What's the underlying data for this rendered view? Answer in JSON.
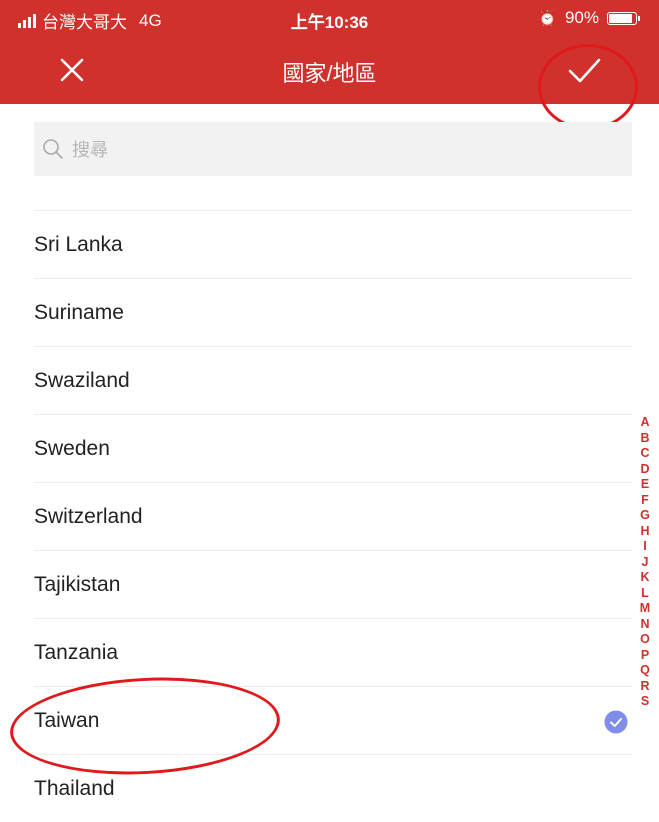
{
  "status_bar": {
    "carrier": "台灣大哥大",
    "network": "4G",
    "time": "上午10:36",
    "battery": "90%",
    "battery_level": 0.9
  },
  "nav": {
    "title": "國家/地區",
    "close_icon": "close-icon",
    "confirm_icon": "checkmark-icon"
  },
  "search": {
    "placeholder": "搜尋",
    "value": ""
  },
  "countries": [
    {
      "name": "Sri Lanka"
    },
    {
      "name": "Suriname"
    },
    {
      "name": "Swaziland"
    },
    {
      "name": "Sweden"
    },
    {
      "name": "Switzerland"
    },
    {
      "name": "Tajikistan"
    },
    {
      "name": "Tanzania"
    },
    {
      "name": "Taiwan",
      "selected": true
    },
    {
      "name": "Thailand"
    }
  ],
  "alphabet_index": [
    "A",
    "B",
    "C",
    "D",
    "E",
    "F",
    "G",
    "H",
    "I",
    "J",
    "K",
    "L",
    "M",
    "N",
    "O",
    "P",
    "Q",
    "R",
    "S"
  ],
  "colors": {
    "brand": "#d0312d",
    "selected_badge": "#7f8de9",
    "annotation": "#e0191c"
  }
}
